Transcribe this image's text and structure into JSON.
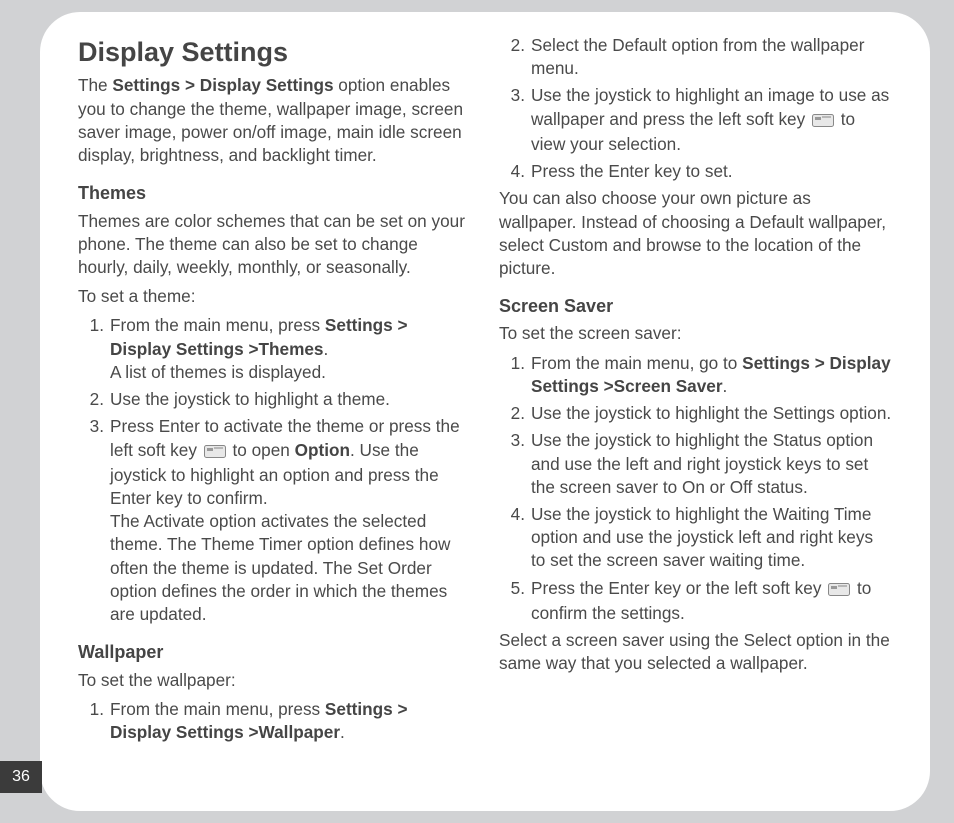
{
  "page_number": "36",
  "title": "Display Settings",
  "intro_pre": "The ",
  "intro_bold": "Settings > Display Settings",
  "intro_post": " option enables you to change the theme, wallpaper image, screen saver image, power on/off image, main idle screen display, brightness, and backlight timer.",
  "themes": {
    "heading": "Themes",
    "desc": "Themes are color schemes that can be set on your phone. The theme can also be set to change hourly, daily, weekly, monthly, or seasonally.",
    "lead": "To set a theme:",
    "step1_pre": "From the main menu, press ",
    "step1_bold": "Settings > Display Settings >Themes",
    "step1_after": "A list of themes is displayed.",
    "step2": "Use the joystick to highlight a theme.",
    "step3_pre": "Press Enter to activate the theme or press the left soft key ",
    "step3_mid": " to open ",
    "step3_bold": "Option",
    "step3_post": ". Use the joystick to highlight an option and press the Enter key to confirm.",
    "step3_after": "The Activate option activates the selected theme. The Theme Timer option defines how often the theme is updated. The Set Order option defines the order in which the themes are updated."
  },
  "wallpaper": {
    "heading": "Wallpaper",
    "lead": "To set the wallpaper:",
    "step1_pre": "From the main menu, press ",
    "step1_bold": "Settings > Display Settings >Wallpaper",
    "step2": "Select the Default option from the wallpaper menu.",
    "step3_pre": "Use the  joystick to highlight an image to use as wallpaper and press the left soft key ",
    "step3_post": " to view your selection.",
    "step4": "Press the Enter key to set.",
    "note": "You can also choose your own picture as wallpaper. Instead of choosing a Default wallpaper, select Custom and browse to the location of the picture."
  },
  "screensaver": {
    "heading": "Screen Saver",
    "lead": "To set the screen saver:",
    "step1_pre": "From the main menu, go to ",
    "step1_bold": "Settings > Display Settings >Screen Saver",
    "step2": "Use the joystick to highlight the Settings option.",
    "step3": "Use the joystick to highlight the Status option and use the left and right joystick keys to set the screen saver to On or Off status.",
    "step4": "Use the joystick to highlight the Waiting Time option and use the joystick left and right keys to set the screen saver waiting time.",
    "step5_pre": "Press the Enter key or the left soft key ",
    "step5_post": " to confirm the settings.",
    "note": "Select a screen saver using the Select option in the same way that you selected a wallpaper."
  }
}
